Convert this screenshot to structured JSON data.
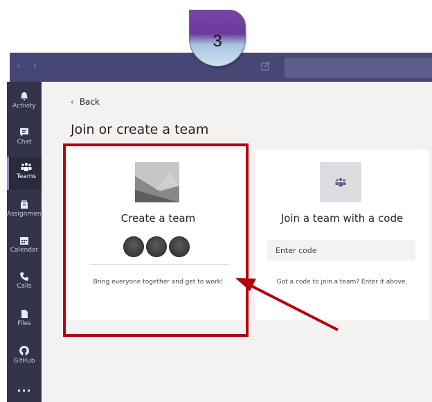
{
  "step_badge": {
    "number": "3"
  },
  "topbar": {
    "back_icon": "chevron-left-icon",
    "forward_icon": "chevron-right-icon",
    "compose_icon": "compose-icon",
    "search_value": "",
    "colors": {
      "bar": "#464775",
      "search": "#5d5e8a"
    }
  },
  "sidebar": {
    "items": [
      {
        "label": "Activity",
        "icon": "bell-icon",
        "active": false
      },
      {
        "label": "Chat",
        "icon": "chat-icon",
        "active": false
      },
      {
        "label": "Teams",
        "icon": "teams-icon",
        "active": true
      },
      {
        "label": "Assignments",
        "icon": "assignments-icon",
        "active": false
      },
      {
        "label": "Calendar",
        "icon": "calendar-icon",
        "active": false
      },
      {
        "label": "Calls",
        "icon": "phone-icon",
        "active": false
      },
      {
        "label": "Files",
        "icon": "file-icon",
        "active": false
      },
      {
        "label": "GitHub",
        "icon": "github-icon",
        "active": false
      },
      {
        "label": "...",
        "icon": "more-icon",
        "active": false
      }
    ]
  },
  "main": {
    "back_label": "Back",
    "page_title": "Join or create a team",
    "create_card": {
      "title": "Create a team",
      "description": "Bring everyone together and get to work!"
    },
    "join_card": {
      "title": "Join a team with a code",
      "code_placeholder": "Enter code",
      "description": "Got a code to join a team? Enter it above."
    }
  },
  "annotation": {
    "highlight_color": "#b5000e",
    "arrow_color": "#b5000e"
  }
}
